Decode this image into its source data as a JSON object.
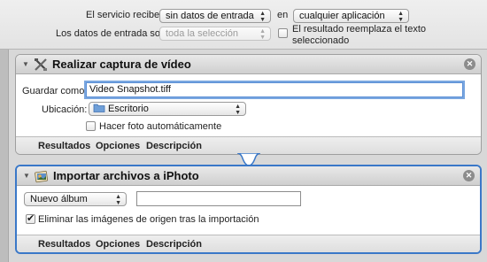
{
  "header": {
    "receives_label": "El servicio recibe",
    "receives_value": "sin datos de entrada",
    "in_label": "en",
    "app_value": "cualquier aplicación",
    "input_label": "Los datos de entrada son",
    "input_value": "toda la selección",
    "replace_line1": "El resultado reemplaza el texto",
    "replace_line2": "seleccionado",
    "replace_checked": false
  },
  "panel1": {
    "title": "Realizar captura de vídeo",
    "icon": "x-tools-icon",
    "save_as_label": "Guardar como:",
    "save_as_value": "Video Snapshot.tiff",
    "location_label": "Ubicación:",
    "location_value": "Escritorio",
    "auto_photo_label": "Hacer foto automáticamente",
    "auto_photo_checked": false,
    "tabs": [
      "Resultados",
      "Opciones",
      "Descripción"
    ]
  },
  "panel2": {
    "title": "Importar archivos a iPhoto",
    "icon": "iphoto-icon",
    "album_value": "Nuevo álbum",
    "album_name_value": "",
    "delete_label": "Eliminar las imágenes de origen tras la importación",
    "delete_checked": true,
    "tabs": [
      "Resultados",
      "Opciones",
      "Descripción"
    ]
  },
  "colors": {
    "selection_border": "#3a78c8",
    "folder_blue": "#6f9fd8"
  }
}
